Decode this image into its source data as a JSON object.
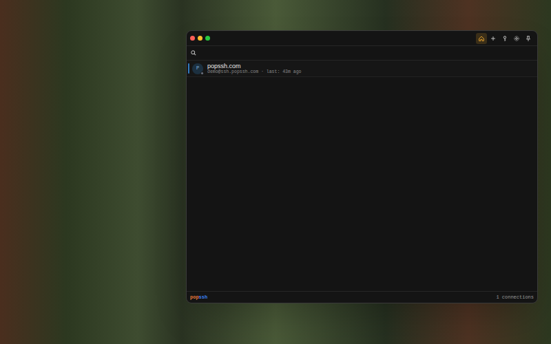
{
  "toolbar": [
    {
      "selected": true
    },
    {
      "selected": false
    },
    {
      "selected": false
    },
    {
      "selected": false
    },
    {
      "selected": false
    }
  ],
  "connections": [
    {
      "avatar": "P",
      "name": "popssh.com",
      "detail": "demo@ssh.popssh.com · last: 43m ago",
      "selected": true,
      "color": "#6b7280"
    }
  ],
  "status_bar": {
    "logo": [
      {
        "text": "pop",
        "color": "#e4763a"
      },
      {
        "text": "ssh",
        "color": "#3b82f6"
      }
    ],
    "count": "1 connections"
  }
}
